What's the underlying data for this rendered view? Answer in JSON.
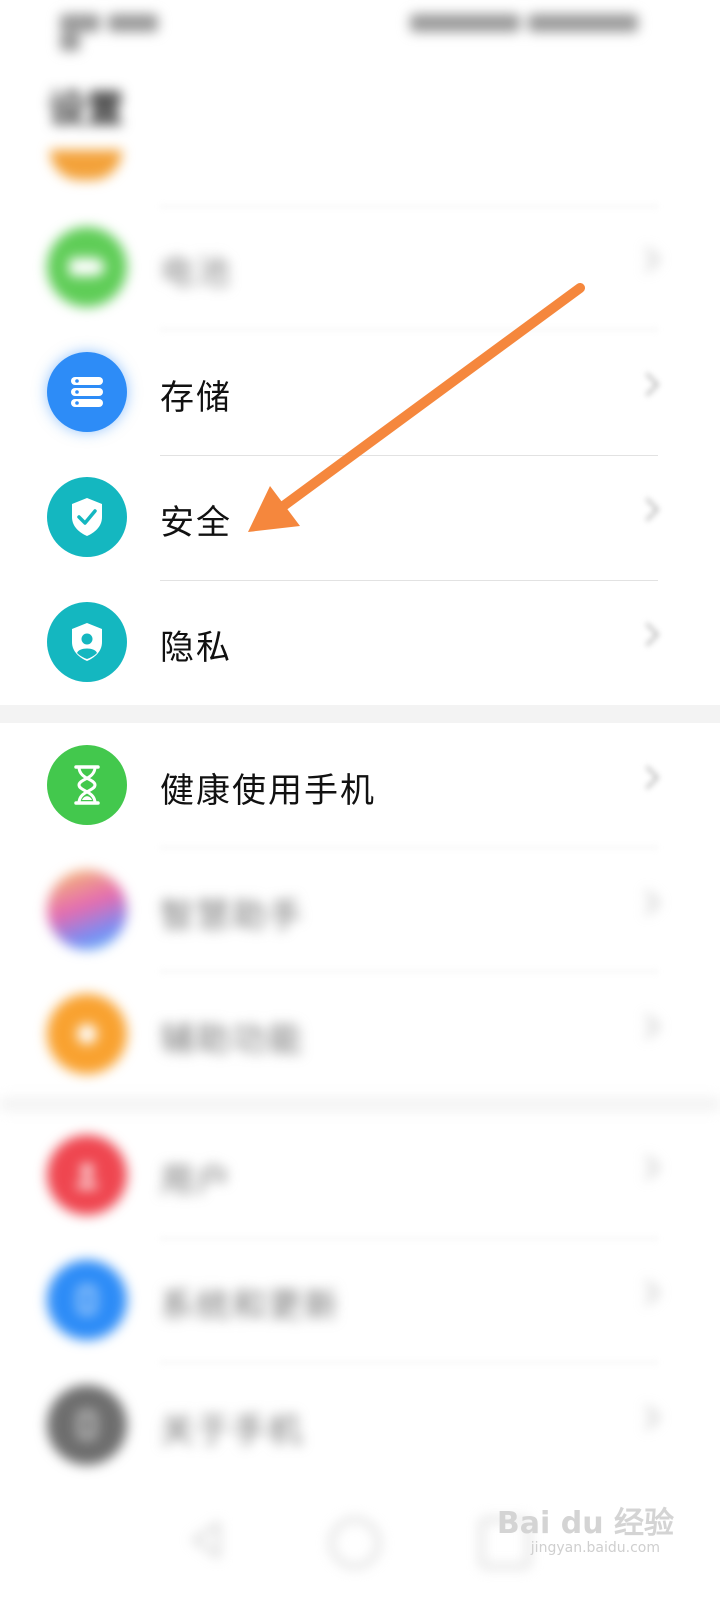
{
  "page": {
    "title": "设置"
  },
  "items": [
    {
      "label": "电池",
      "icon": "battery-icon",
      "color": "#5fcd57"
    },
    {
      "label": "存储",
      "icon": "storage-icon",
      "color": "#2d8cf7"
    },
    {
      "label": "安全",
      "icon": "shield-check-icon",
      "color": "#14b7c0"
    },
    {
      "label": "隐私",
      "icon": "privacy-shield-icon",
      "color": "#14b7c0"
    },
    {
      "label": "健康使用手机",
      "icon": "hourglass-icon",
      "color": "#43c84d"
    },
    {
      "label": "智慧助手",
      "icon": "assistant-icon",
      "color": "#a97cf0"
    },
    {
      "label": "辅助功能",
      "icon": "accessibility-icon",
      "color": "#f9a230"
    },
    {
      "label": "用户",
      "icon": "user-icon",
      "color": "#ef4650"
    },
    {
      "label": "系统和更新",
      "icon": "system-update-icon",
      "color": "#2d8cf7"
    },
    {
      "label": "关于手机",
      "icon": "phone-info-icon",
      "color": "#6e6e6e"
    }
  ],
  "watermark": {
    "text": "Bai du 经验",
    "sub": "jingyan.baidu.com"
  },
  "colors": {
    "arrow": "#f5873d"
  }
}
